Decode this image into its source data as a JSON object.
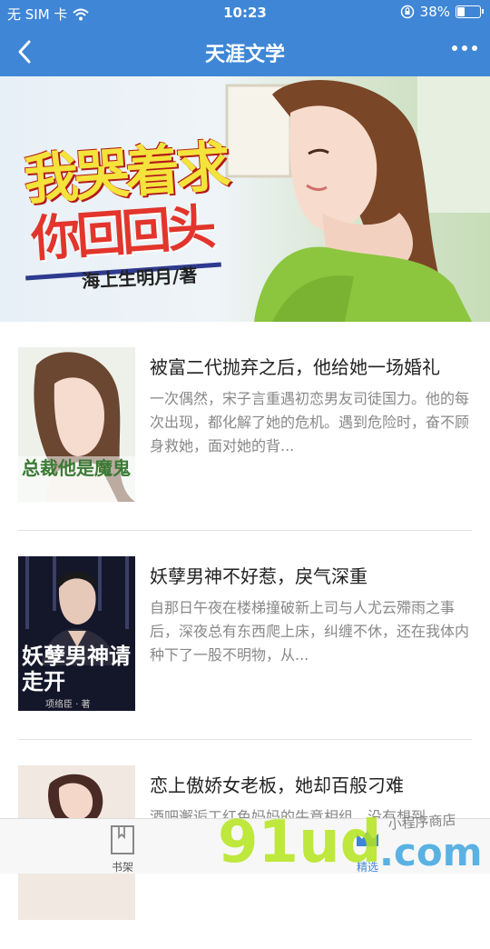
{
  "status_bar": {
    "carrier": "无 SIM 卡",
    "time": "10:23",
    "battery": "38%",
    "battery_level": 0.38
  },
  "nav": {
    "title": "天涯文学"
  },
  "banner": {
    "title_line1": "我哭着求",
    "title_line2": "你回回头",
    "author": "海上生明月/著",
    "dot_count": 4,
    "active_dot": 2
  },
  "books": [
    {
      "title": "被富二代抛弃之后，他给她一场婚礼",
      "description": "一次偶然，宋子言重遇初恋男友司徒国力。他的每次出现，都化解了她的危机。遇到危险时，奋不顾身救她，面对她的背...",
      "cover_text": "总裁他是魔鬼"
    },
    {
      "title": "妖孽男神不好惹，戾气深重",
      "description": "自那日午夜在楼梯撞破新上司与人尤云殢雨之事后，深夜总有东西爬上床，纠缠不休，还在我体内种下了一股不明物，从...",
      "cover_text": "妖孽男神请走开",
      "cover_author": "项络臣 · 著"
    },
    {
      "title": "恋上傲娇女老板，她却百般刁难",
      "description": "酒吧邂逅工红色妈妈的牛意相组，没有想到",
      "cover_text": ""
    }
  ],
  "tabbar": {
    "left_label": "书架",
    "right_label": "精选"
  },
  "watermark": {
    "text": "91ud.com",
    "tagline": "小程序商店"
  },
  "colors": {
    "primary": "#3f86d6",
    "title_text": "#222222",
    "desc_text": "#888888"
  }
}
